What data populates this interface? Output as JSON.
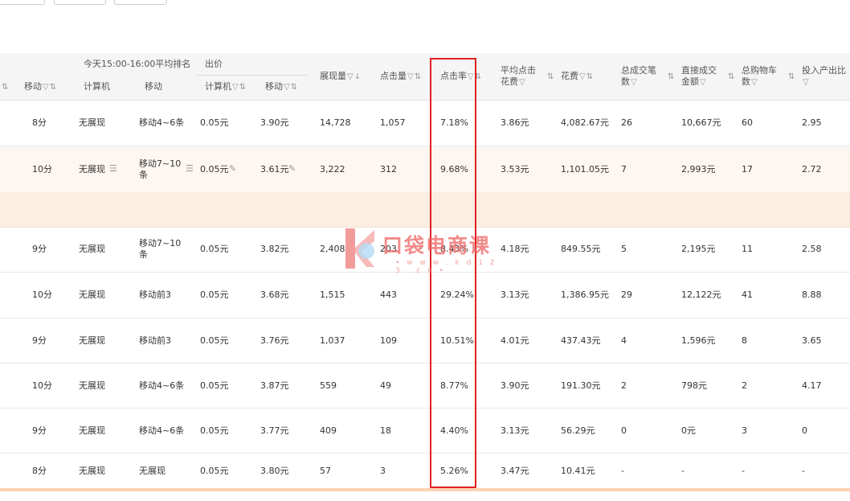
{
  "header": {
    "group_rank": "今天15:00-16:00平均排名",
    "group_bid": "出价",
    "col_mobile_left": "移动",
    "col_rank_pc": "计算机",
    "col_rank_mobile": "移动",
    "col_bid_pc": "计算机",
    "col_bid_mobile": "移动",
    "col_impressions": "展现量",
    "col_clicks": "点击量",
    "col_ctr": "点击率",
    "col_avg_cpc": "平均点击花费",
    "col_spend": "花费",
    "col_total_orders": "总成交笔数",
    "col_direct_gmv": "直接成交金额",
    "col_total_cart": "总购物车数",
    "col_roi": "投入产出比"
  },
  "rows": [
    {
      "mobile_score": "8分",
      "rank_pc": "无展现",
      "rank_mobile": "移动4~6条",
      "bid_pc": "0.05元",
      "bid_mobile": "3.90元",
      "impressions": "14,728",
      "clicks": "1,057",
      "ctr": "7.18%",
      "avg_cpc": "3.86元",
      "spend": "4,082.67元",
      "orders": "26",
      "gmv": "10,667元",
      "cart": "60",
      "roi": "2.95"
    },
    {
      "mobile_score": "10分",
      "rank_pc": "无展现",
      "rank_mobile": "移动7~10条",
      "bid_pc": "0.05元",
      "bid_mobile": "3.61元",
      "impressions": "3,222",
      "clicks": "312",
      "ctr": "9.68%",
      "avg_cpc": "3.53元",
      "spend": "1,101.05元",
      "orders": "7",
      "gmv": "2,993元",
      "cart": "17",
      "roi": "2.72"
    },
    {
      "mobile_score": "9分",
      "rank_pc": "无展现",
      "rank_mobile": "移动7~10条",
      "bid_pc": "0.05元",
      "bid_mobile": "3.82元",
      "impressions": "2,408",
      "clicks": "203",
      "ctr": "8.43%",
      "avg_cpc": "4.18元",
      "spend": "849.55元",
      "orders": "5",
      "gmv": "2,195元",
      "cart": "11",
      "roi": "2.58"
    },
    {
      "mobile_score": "10分",
      "rank_pc": "无展现",
      "rank_mobile": "移动前3",
      "bid_pc": "0.05元",
      "bid_mobile": "3.68元",
      "impressions": "1,515",
      "clicks": "443",
      "ctr": "29.24%",
      "avg_cpc": "3.13元",
      "spend": "1,386.95元",
      "orders": "29",
      "gmv": "12,122元",
      "cart": "41",
      "roi": "8.88"
    },
    {
      "mobile_score": "9分",
      "rank_pc": "无展现",
      "rank_mobile": "移动前3",
      "bid_pc": "0.05元",
      "bid_mobile": "3.76元",
      "impressions": "1,037",
      "clicks": "109",
      "ctr": "10.51%",
      "avg_cpc": "4.01元",
      "spend": "437.43元",
      "orders": "4",
      "gmv": "1,596元",
      "cart": "8",
      "roi": "3.65"
    },
    {
      "mobile_score": "10分",
      "rank_pc": "无展现",
      "rank_mobile": "移动4~6条",
      "bid_pc": "0.05元",
      "bid_mobile": "3.87元",
      "impressions": "559",
      "clicks": "49",
      "ctr": "8.77%",
      "avg_cpc": "3.90元",
      "spend": "191.30元",
      "orders": "2",
      "gmv": "798元",
      "cart": "2",
      "roi": "4.17"
    },
    {
      "mobile_score": "9分",
      "rank_pc": "无展现",
      "rank_mobile": "移动4~6条",
      "bid_pc": "0.05元",
      "bid_mobile": "3.77元",
      "impressions": "409",
      "clicks": "18",
      "ctr": "4.40%",
      "avg_cpc": "3.13元",
      "spend": "56.29元",
      "orders": "0",
      "gmv": "0元",
      "cart": "3",
      "roi": "0"
    },
    {
      "mobile_score": "8分",
      "rank_pc": "无展现",
      "rank_mobile": "无展现",
      "bid_pc": "0.05元",
      "bid_mobile": "3.80元",
      "impressions": "57",
      "clicks": "3",
      "ctr": "5.26%",
      "avg_cpc": "3.47元",
      "spend": "10.41元",
      "orders": "-",
      "gmv": "-",
      "cart": "-",
      "roi": "-"
    }
  ],
  "watermark": {
    "title": "口袋电商课",
    "url": "• w w w . k d 1 2 3 . c n •"
  },
  "colors": {
    "highlight_border": "#e02020",
    "row_alt_bg": "#fdf6f1",
    "accent_orange": "#fbd3b4"
  }
}
